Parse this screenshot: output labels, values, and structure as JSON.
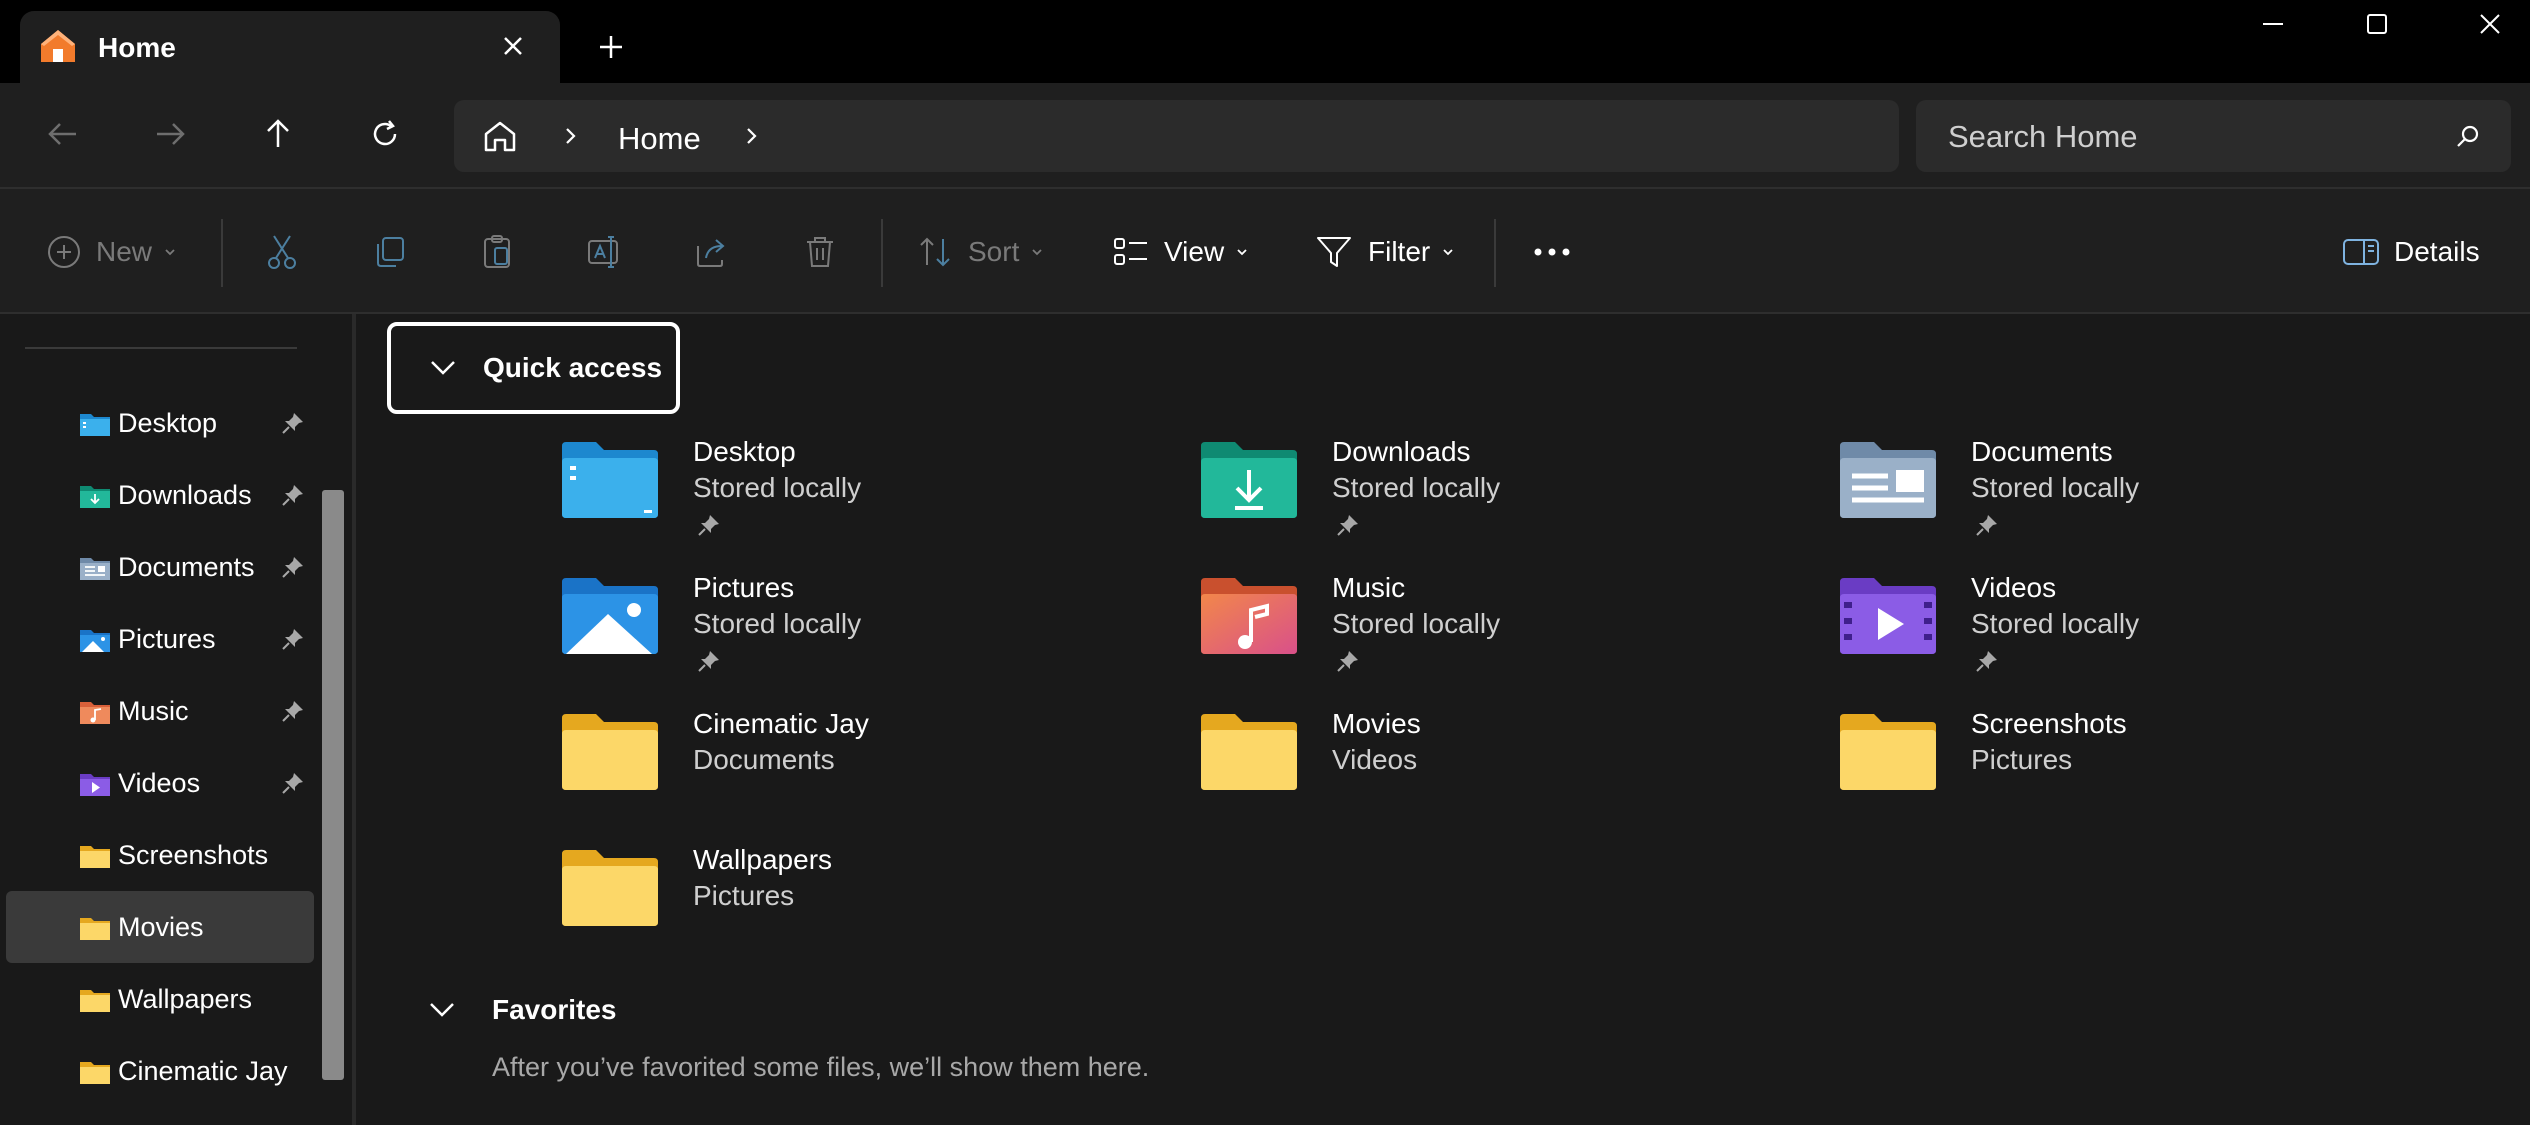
{
  "tab": {
    "title": "Home"
  },
  "address": {
    "location": "Home"
  },
  "search": {
    "placeholder": "Search Home"
  },
  "commands": {
    "new": "New",
    "sort": "Sort",
    "view": "View",
    "filter": "Filter",
    "details": "Details"
  },
  "sidebar": {
    "items": [
      {
        "label": "Desktop",
        "icon": "desktop-folder-icon",
        "pinned": true
      },
      {
        "label": "Downloads",
        "icon": "downloads-folder-icon",
        "pinned": true
      },
      {
        "label": "Documents",
        "icon": "documents-folder-icon",
        "pinned": true
      },
      {
        "label": "Pictures",
        "icon": "pictures-folder-icon",
        "pinned": true
      },
      {
        "label": "Music",
        "icon": "music-folder-icon",
        "pinned": true
      },
      {
        "label": "Videos",
        "icon": "videos-folder-icon",
        "pinned": true
      },
      {
        "label": "Screenshots",
        "icon": "folder-icon",
        "pinned": false
      },
      {
        "label": "Movies",
        "icon": "folder-icon",
        "pinned": false,
        "selected": true
      },
      {
        "label": "Wallpapers",
        "icon": "folder-icon",
        "pinned": false
      },
      {
        "label": "Cinematic Jay",
        "icon": "folder-icon",
        "pinned": false
      }
    ]
  },
  "quick_access": {
    "title": "Quick access",
    "items": [
      {
        "name": "Desktop",
        "location": "Stored locally",
        "pinned": true,
        "icon": "desktop-folder-icon"
      },
      {
        "name": "Downloads",
        "location": "Stored locally",
        "pinned": true,
        "icon": "downloads-folder-icon"
      },
      {
        "name": "Documents",
        "location": "Stored locally",
        "pinned": true,
        "icon": "documents-folder-icon"
      },
      {
        "name": "Pictures",
        "location": "Stored locally",
        "pinned": true,
        "icon": "pictures-folder-icon"
      },
      {
        "name": "Music",
        "location": "Stored locally",
        "pinned": true,
        "icon": "music-folder-icon"
      },
      {
        "name": "Videos",
        "location": "Stored locally",
        "pinned": true,
        "icon": "videos-folder-icon"
      },
      {
        "name": "Cinematic Jay",
        "location": "Documents",
        "pinned": false,
        "icon": "folder-icon"
      },
      {
        "name": "Movies",
        "location": "Videos",
        "pinned": false,
        "icon": "folder-icon"
      },
      {
        "name": "Screenshots",
        "location": "Pictures",
        "pinned": false,
        "icon": "folder-icon"
      },
      {
        "name": "Wallpapers",
        "location": "Pictures",
        "pinned": false,
        "icon": "folder-icon"
      }
    ]
  },
  "favorites": {
    "title": "Favorites",
    "empty_message": "After you’ve favorited some files, we’ll show them here."
  },
  "colors": {
    "accent_home": "#f27b2c",
    "folder_yellow": "#fcd768",
    "selection": "#3a3a3a"
  }
}
